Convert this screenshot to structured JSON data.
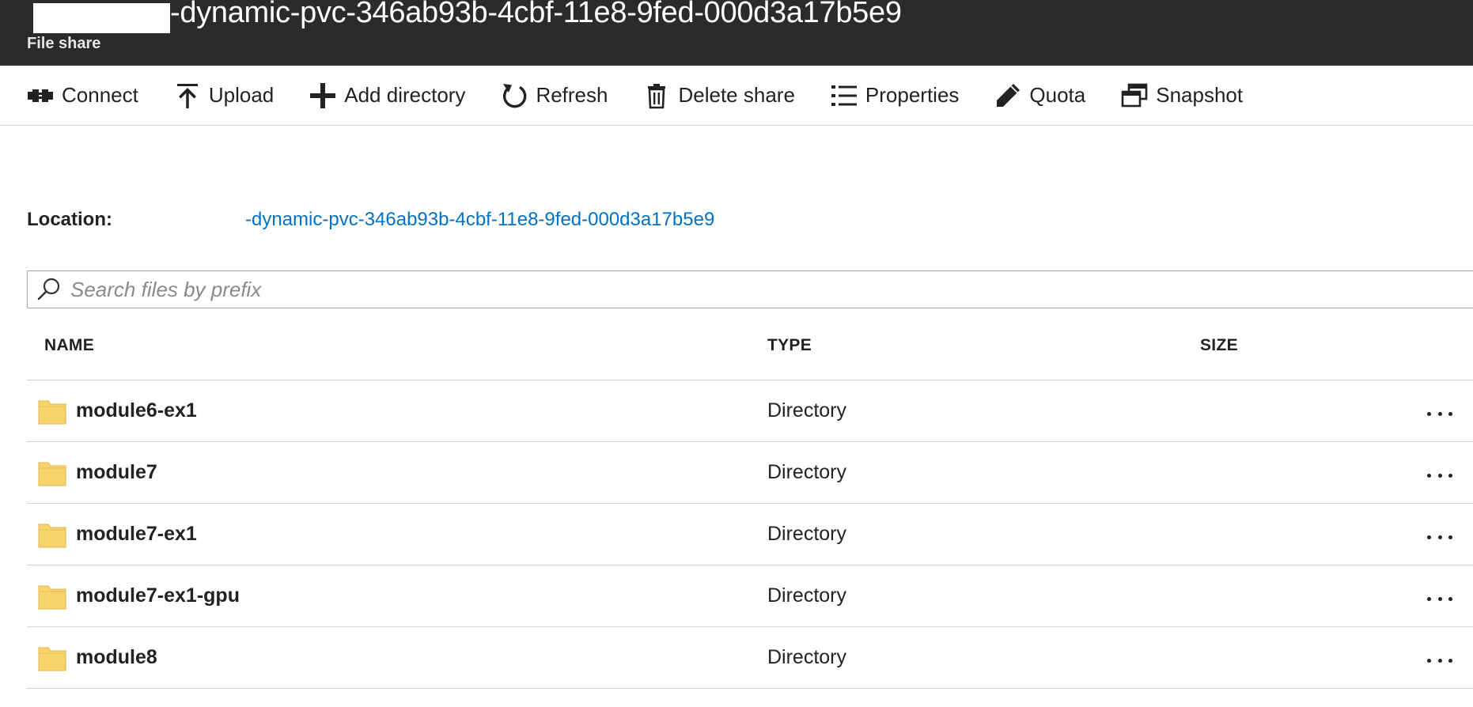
{
  "header": {
    "title": "-dynamic-pvc-346ab93b-4cbf-11e8-9fed-000d3a17b5e9",
    "subtitle": "File share"
  },
  "toolbar": {
    "connect_label": "Connect",
    "upload_label": "Upload",
    "add_directory_label": "Add directory",
    "refresh_label": "Refresh",
    "delete_share_label": "Delete share",
    "properties_label": "Properties",
    "quota_label": "Quota",
    "snapshot_label": "Snapshot"
  },
  "location": {
    "label": "Location:",
    "path": "-dynamic-pvc-346ab93b-4cbf-11e8-9fed-000d3a17b5e9"
  },
  "search": {
    "placeholder": "Search files by prefix",
    "value": ""
  },
  "table": {
    "columns": {
      "name": "NAME",
      "type": "TYPE",
      "size": "SIZE"
    },
    "rows": [
      {
        "name": "module6-ex1",
        "type": "Directory",
        "size": ""
      },
      {
        "name": "module7",
        "type": "Directory",
        "size": ""
      },
      {
        "name": "module7-ex1",
        "type": "Directory",
        "size": ""
      },
      {
        "name": "module7-ex1-gpu",
        "type": "Directory",
        "size": ""
      },
      {
        "name": "module8",
        "type": "Directory",
        "size": ""
      }
    ]
  },
  "colors": {
    "header_bg": "#2b2b2b",
    "link": "#0072c6",
    "folder": "#f6d36b"
  },
  "icons": {
    "connect": "connect-icon",
    "upload": "upload-icon",
    "add_directory": "plus-icon",
    "refresh": "refresh-icon",
    "delete_share": "trash-icon",
    "properties": "list-icon",
    "quota": "pencil-icon",
    "snapshot": "snapshot-icon",
    "search": "search-icon",
    "folder": "folder-icon",
    "more": "more-icon"
  }
}
